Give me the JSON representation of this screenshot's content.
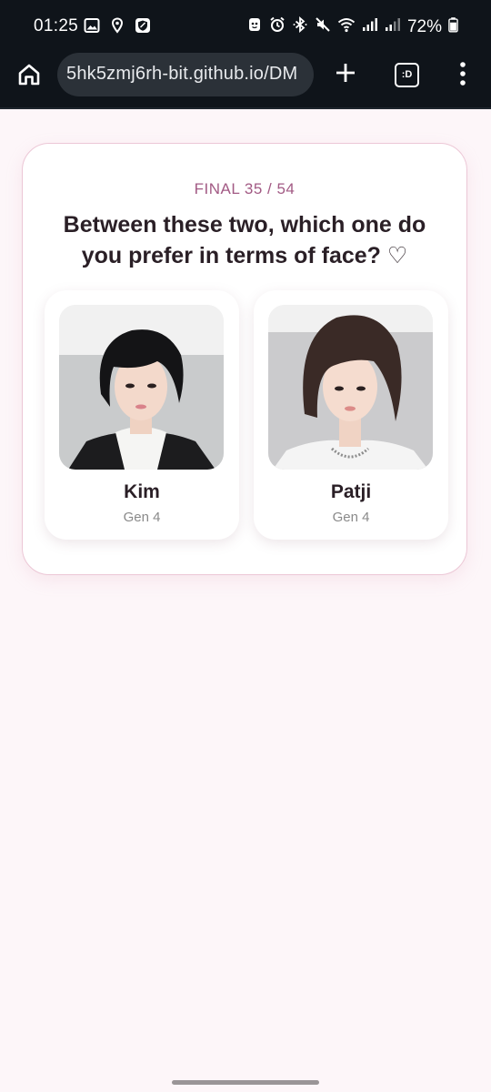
{
  "status_bar": {
    "time": "01:25",
    "battery": "72%",
    "left_icons": [
      "image-icon",
      "location-pin-icon",
      "shield-app-icon"
    ],
    "right_icons": [
      "bixby-icon",
      "alarm-icon",
      "bluetooth-icon",
      "mute-icon",
      "wifi-icon",
      "signal-icon",
      "signal-icon-2",
      "battery-icon"
    ]
  },
  "browser": {
    "url": "5hk5zmj6rh-bit.github.io/DM",
    "tab_switcher_label": ":D"
  },
  "quiz": {
    "progress": "FINAL 35 / 54",
    "question": "Between these two, which one do you prefer in terms of face? ♡",
    "choices": [
      {
        "name": "Kim",
        "gen": "Gen 4"
      },
      {
        "name": "Patji",
        "gen": "Gen 4"
      }
    ]
  },
  "colors": {
    "accent": "#a25a84",
    "page_background": "#fdf6f9",
    "card_border": "#ecc7d6",
    "system_bar": "#0f141a"
  }
}
